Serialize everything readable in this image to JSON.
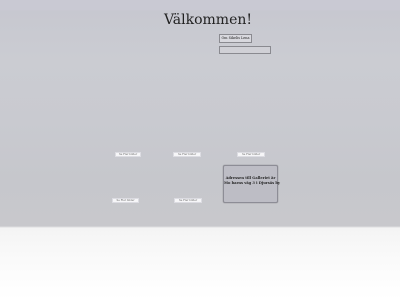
{
  "header": {
    "title": "Välkommen!"
  },
  "nav": {
    "button_label": "Om Sikelis Lena"
  },
  "search": {
    "value": ""
  },
  "links": [
    {
      "label": "Se Fler bilder"
    },
    {
      "label": "Se Fler bilder"
    },
    {
      "label": "Se Fler bilder"
    },
    {
      "label": "Se Fler bilder"
    },
    {
      "label": "Se Fler bilder"
    }
  ],
  "address": {
    "line1": "Adressen till Galleriet är",
    "line2": "Mo barns väg 3 i Djursäs by"
  },
  "colors": {
    "background": "#c9cad0",
    "footer": "#ffffff",
    "box": "#bdbdc5"
  }
}
